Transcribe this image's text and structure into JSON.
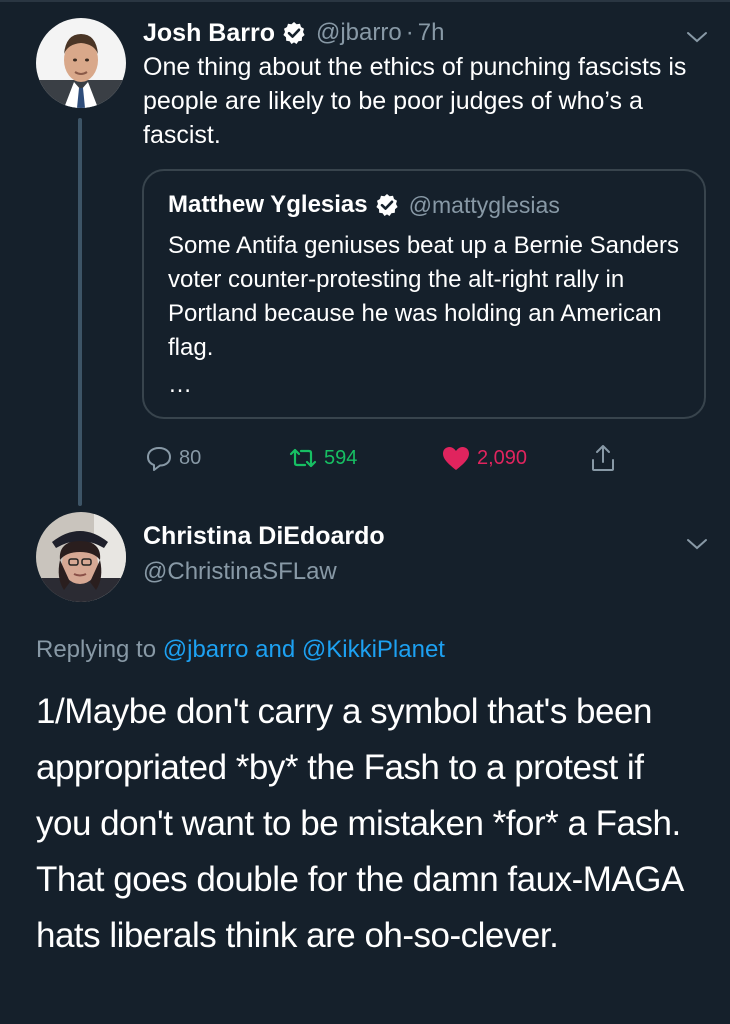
{
  "colors": {
    "background": "#15202b",
    "secondary_text": "#8899a6",
    "link": "#1da1f2",
    "retweet": "#17bf63",
    "like": "#e0245e",
    "border": "#38444d"
  },
  "tweet": {
    "author_name": "Josh Barro",
    "handle": "@jbarro",
    "separator": "·",
    "time": "7h",
    "text": "One thing about the ethics of punching fascists is people are likely to be poor judges of who’s a fascist.",
    "quoted": {
      "author_name": "Matthew Yglesias",
      "handle": "@mattyglesias",
      "text": "Some Antifa geniuses beat up a Bernie Sanders voter counter-protesting the alt-right rally in Portland because he was holding an American flag.",
      "ellipsis": "…"
    },
    "actions": {
      "replies": "80",
      "retweets": "594",
      "likes": "2,090"
    }
  },
  "reply": {
    "author_name": "Christina DiEdoardo",
    "handle": "@ChristinaSFLaw",
    "replying_prefix": "Replying to",
    "mention1": "@jbarro",
    "conjunction": "and",
    "mention2": "@KikkiPlanet",
    "text": "1/Maybe don't carry a symbol that's been appropriated *by* the Fash to a protest if you don't want to be mistaken *for* a Fash. That goes double for the damn faux-MAGA hats liberals think are oh-so-clever."
  },
  "icons": {
    "verified": "verified-badge-icon",
    "caret": "chevron-down-icon",
    "reply": "reply-bubble-icon",
    "retweet": "retweet-icon",
    "like": "heart-icon",
    "share": "share-icon"
  }
}
